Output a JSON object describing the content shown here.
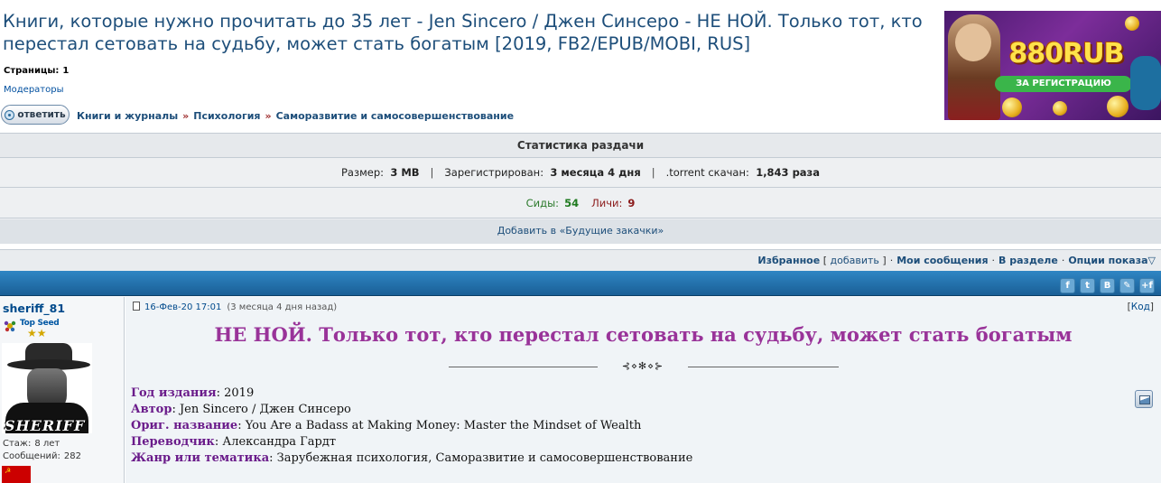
{
  "topic": {
    "title": "Книги, которые нужно прочитать до 35 лет - Jen Sincero / Джен Синсеро - НЕ НОЙ. Только тот, кто перестал сетовать на судьбу, может стать богатым [2019, FB2/EPUB/MOBI, RUS]",
    "pages_label": "Страницы:",
    "pages_value": "1",
    "moderators": "Модераторы",
    "reply_label": "ответить"
  },
  "breadcrumb": [
    "Книги и журналы",
    "Психология",
    "Саморазвитие и самосовершенствование"
  ],
  "breadcrumb_sep": "»",
  "banner": {
    "logo": "880RUB",
    "tagline": "ЗА РЕГИСТРАЦИЮ"
  },
  "stats": {
    "header": "Статистика раздачи",
    "size_label": "Размер:",
    "size_value": "3 MB",
    "registered_label": "Зарегистрирован:",
    "registered_value": "3 месяца 4 дня",
    "downloaded_label": ".torrent скачан:",
    "downloaded_value": "1,843 раза",
    "separator": "|",
    "seeds_label": "Сиды:",
    "seeds_value": "54",
    "leechers_label": "Личи:",
    "leechers_value": "9",
    "future_link": "Добавить в «Будущие закачки»"
  },
  "links_bar": {
    "favorites": "Избранное",
    "add_open": "[",
    "add": "добавить",
    "add_close": "]",
    "my_messages": "Мои сообщения",
    "in_section": "В разделе",
    "show_options": "Опции показа",
    "dot": "·",
    "options_arrow": "▽"
  },
  "social": [
    "f",
    "t",
    "B",
    "✎",
    "+f"
  ],
  "post": {
    "author": {
      "nick": "sheriff_81",
      "rank": "Top Seed",
      "stars": "★★",
      "avatar_text": "SHERIFF",
      "experience_label": "Стаж:",
      "experience_value": "8 лет",
      "messages_label": "Сообщений:",
      "messages_value": "282",
      "flag_symbol": "☭"
    },
    "date": "16-Фев-20 17:01",
    "ago": "(3 месяца 4 дня назад)",
    "code_open": "[",
    "code_label": "Код",
    "code_close": "]",
    "title": "НЕ НОЙ. Только тот, кто перестал сетовать на судьбу, может стать богатым",
    "ornament": "⊰⋄✻⋄⊱",
    "fields": [
      {
        "label": "Год издания",
        "value": "2019"
      },
      {
        "label": "Автор",
        "value": "Jen Sincero / Джен Синсеро"
      },
      {
        "label": "Ориг. название",
        "value": "You Are a Badass at Making Money: Master the Mindset of Wealth"
      },
      {
        "label": "Переводчик",
        "value": "Александра Гардт"
      },
      {
        "label": "Жанр или тематика",
        "value": "Зарубежная психология, Саморазвитие и самосовершенствование"
      }
    ]
  }
}
